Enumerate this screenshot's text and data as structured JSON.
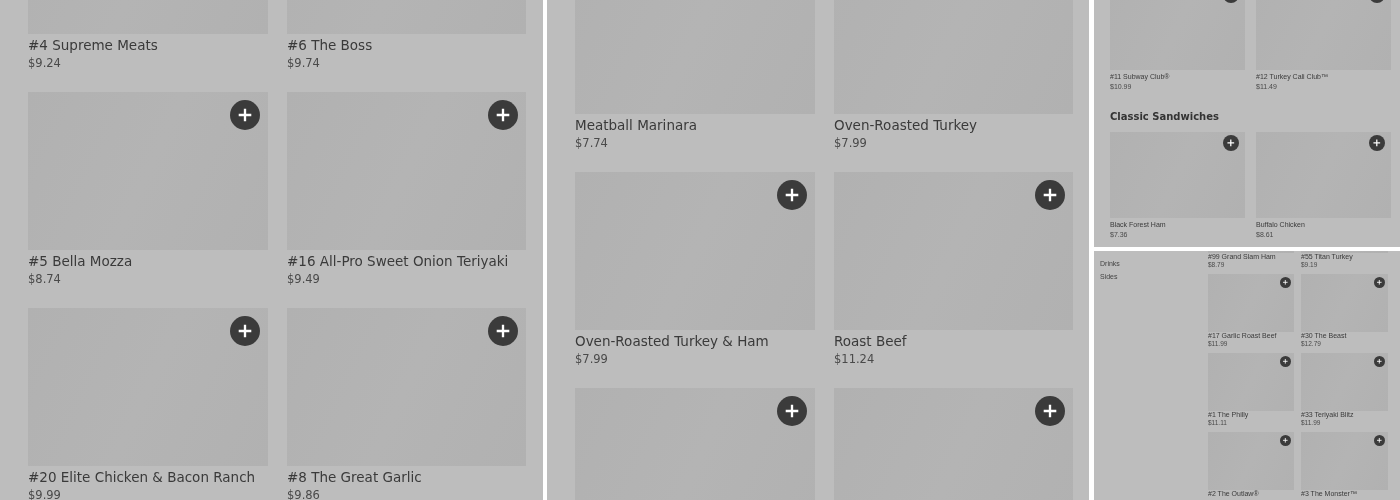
{
  "panels": [
    {
      "kind": "large",
      "sections": [
        {
          "items": [
            {
              "kind": "product",
              "name": "#4 Supreme Meats",
              "price": "$9.24"
            },
            {
              "kind": "product",
              "name": "#6 The Boss",
              "price": "$9.74"
            },
            {
              "kind": "product",
              "name": "#5 Bella Mozza",
              "price": "$8.74",
              "add_button": true
            },
            {
              "kind": "product",
              "name": "#16 All-Pro Sweet Onion Teriyaki",
              "price": "$9.49",
              "add_button": true
            },
            {
              "kind": "product",
              "name": "#20 Elite Chicken & Bacon Ranch",
              "price": "$9.99",
              "add_button": true
            },
            {
              "kind": "product",
              "name": "#8 The Great Garlic",
              "price": "$9.86",
              "add_button": true
            }
          ]
        }
      ]
    },
    {
      "kind": "large",
      "sections": [
        {
          "items": [
            {
              "kind": "product",
              "name": "Meatball Marinara",
              "price": "$7.74"
            },
            {
              "kind": "product",
              "name": "Oven-Roasted Turkey",
              "price": "$7.99"
            },
            {
              "kind": "product",
              "name": "Oven-Roasted Turkey & Ham",
              "price": "$7.99",
              "add_button": true
            },
            {
              "kind": "product",
              "name": "Roast Beef",
              "price": "$11.24",
              "add_button": true
            },
            {
              "kind": "product",
              "add_button": true
            },
            {
              "kind": "product",
              "add_button": true
            }
          ]
        }
      ]
    },
    {
      "kind": "medium",
      "sections": [
        {
          "items": [
            {
              "kind": "product",
              "name": "#11 Subway Club®",
              "price": "$10.99",
              "add_button": true
            },
            {
              "kind": "product",
              "name": "#12 Turkey Cali Club™",
              "price": "$11.49",
              "add_button": true
            }
          ]
        },
        {
          "title": "Classic Sandwiches",
          "items": [
            {
              "kind": "product",
              "name": "Black Forest Ham",
              "price": "$7.36",
              "add_button": true
            },
            {
              "kind": "product",
              "name": "Buffalo Chicken",
              "price": "$8.61",
              "add_button": true
            }
          ]
        }
      ]
    },
    {
      "kind": "small",
      "sidebar": [
        "Drinks",
        "Sides"
      ],
      "sections": [
        {
          "items": [
            {
              "kind": "product",
              "name": "#99 Grand Slam Ham",
              "price": "$8.79"
            },
            {
              "kind": "product",
              "name": "#55 Titan Turkey",
              "price": "$9.19"
            },
            {
              "kind": "product",
              "name": "#17 Garlic Roast Beef",
              "price": "$11.99",
              "add_button": true
            },
            {
              "kind": "product",
              "name": "#30 The Beast",
              "price": "$12.79",
              "add_button": true
            },
            {
              "kind": "product",
              "name": "#1 The Philly",
              "price": "$11.11",
              "add_button": true
            },
            {
              "kind": "product",
              "name": "#33 Teriyaki Blitz",
              "price": "$11.99",
              "add_button": true
            },
            {
              "kind": "product",
              "name": "#2 The Outlaw®",
              "add_button": true
            },
            {
              "kind": "product",
              "name": "#3 The Monster™",
              "add_button": true
            }
          ]
        }
      ]
    }
  ]
}
